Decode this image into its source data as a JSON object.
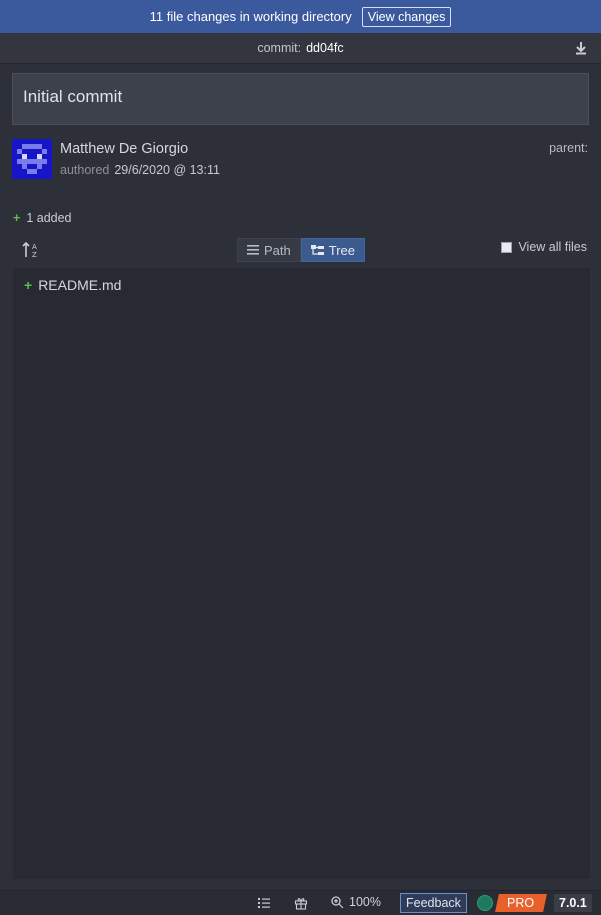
{
  "banner": {
    "message": "11 file changes in working directory",
    "view_changes": "View changes"
  },
  "commit": {
    "label": "commit:",
    "sha": "dd04fc"
  },
  "message": "Initial commit",
  "author": {
    "name": "Matthew De Giorgio",
    "authored_label": "authored",
    "date": "29/6/2020 @ 13:11",
    "parent_label": "parent:",
    "avatar_color": "#1616c8"
  },
  "summary": {
    "added": "1 added"
  },
  "view_toggle": {
    "path": "Path",
    "tree": "Tree",
    "active": "Tree"
  },
  "view_all": {
    "label": "View all files",
    "checked": false
  },
  "files": [
    {
      "name": "README.md",
      "status": "added"
    }
  ],
  "statusbar": {
    "zoom": "100%",
    "feedback": "Feedback",
    "pro": "PRO",
    "version": "7.0.1"
  },
  "colors": {
    "accent": "#3b5a9e",
    "added": "#5cbd4a",
    "pro": "#e8612c"
  }
}
